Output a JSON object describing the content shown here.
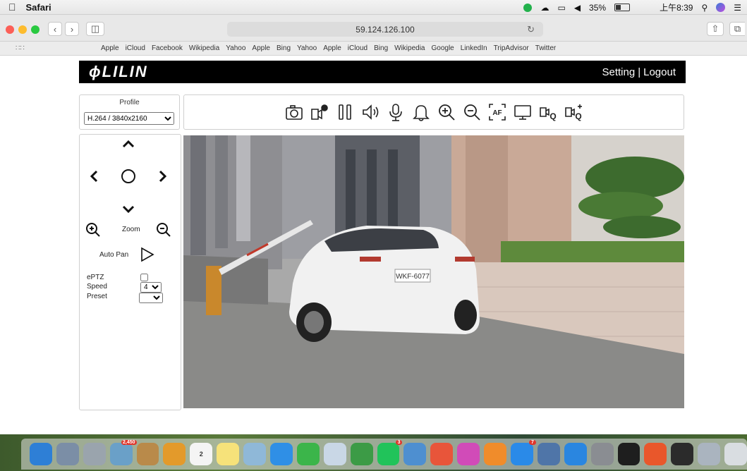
{
  "menubar": {
    "app_name": "Safari",
    "battery": "35%",
    "clock": "上午8:39"
  },
  "toolbar": {
    "address": "59.124.126.100"
  },
  "bookmarks": [
    "Apple",
    "iCloud",
    "Facebook",
    "Wikipedia",
    "Yahoo",
    "Apple",
    "Bing",
    "Yahoo",
    "Apple",
    "iCloud",
    "Bing",
    "Wikipedia",
    "Google",
    "LinkedIn",
    "TripAdvisor",
    "Twitter"
  ],
  "camera": {
    "logo": "LILIN",
    "setting_label": "Setting",
    "separator": "|",
    "logout_label": "Logout",
    "profile_label": "Profile",
    "profile_value": "H.264 / 3840x2160",
    "zoom_label": "Zoom",
    "auto_pan_label": "Auto Pan",
    "eptz_label": "ePTZ",
    "speed_label": "Speed",
    "speed_value": "4",
    "preset_label": "Preset",
    "preset_value": ""
  },
  "video": {
    "plate": "WKF-6077"
  },
  "dock": {
    "badges": [
      "2,450",
      "2",
      "3",
      "7"
    ]
  }
}
